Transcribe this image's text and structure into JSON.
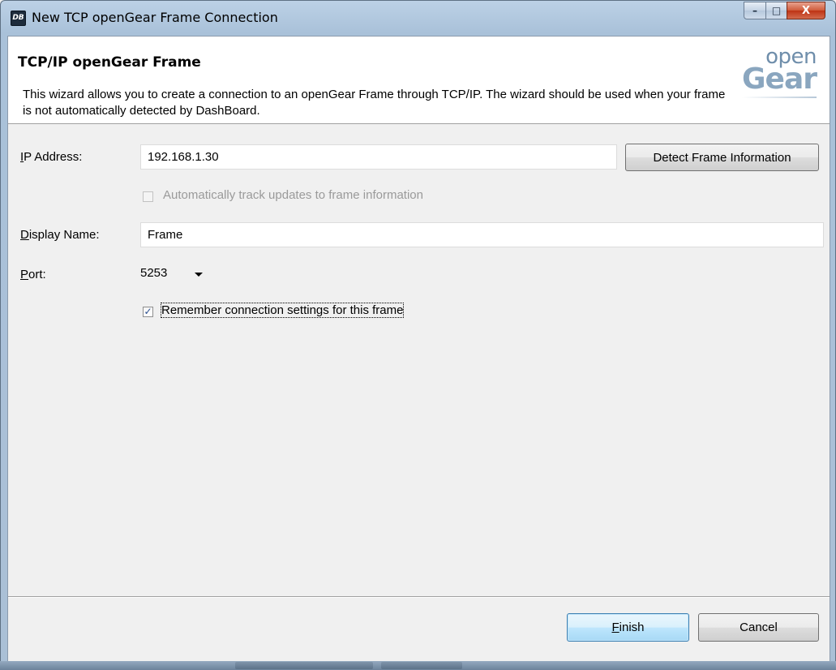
{
  "window": {
    "title": "New TCP openGear Frame Connection",
    "app_icon_text": "DB"
  },
  "title_buttons": {
    "minimize": "–",
    "maximize": "□",
    "close": "X"
  },
  "banner": {
    "title": "TCP/IP openGear Frame",
    "description": "This wizard allows you to create a connection to an openGear Frame through TCP/IP.  The wizard should be used when your frame is not automatically detected by DashBoard.",
    "logo_top": "open",
    "logo_bottom": "Gear"
  },
  "form": {
    "ip_address": {
      "label_mnemonic": "I",
      "label_rest": "P Address:",
      "value": "192.168.1.30"
    },
    "detect_button": "Detect Frame Information",
    "auto_track": {
      "label": "Automatically track updates to frame information",
      "checked": false,
      "enabled": false
    },
    "display_name": {
      "label_mnemonic": "D",
      "label_rest": "isplay Name:",
      "value": "Frame"
    },
    "port": {
      "label_mnemonic": "P",
      "label_rest": "ort:",
      "value": "5253"
    },
    "remember": {
      "label": "Remember connection settings for this frame",
      "checked": true,
      "check_glyph": "✓"
    }
  },
  "footer": {
    "finish_mnemonic": "F",
    "finish_rest": "inish",
    "cancel": "Cancel"
  },
  "colors": {
    "frame": "#aac0d6",
    "banner_bg": "#ffffff",
    "client_bg": "#f0f0f0",
    "default_button": "#bee6fd",
    "close_button": "#cf5a3a"
  }
}
